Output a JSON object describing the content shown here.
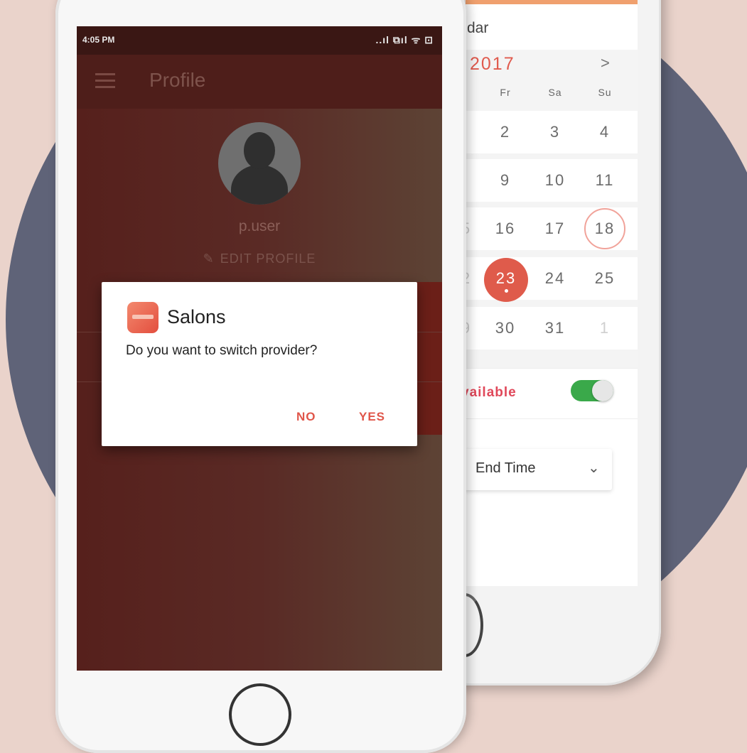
{
  "status_bar": {
    "time": "4:05 PM",
    "icons_text": "..ıl ⧉ıl ᯤ ⊡"
  },
  "profile": {
    "title": "Profile",
    "username": "p.user",
    "edit_label": "EDIT PROFILE"
  },
  "dialog": {
    "app_name": "Salons",
    "message": "Do you want to switch provider?",
    "no_label": "NO",
    "yes_label": "YES"
  },
  "calendar": {
    "header_fragment": "dar",
    "month_label": "2017",
    "next_glyph": ">",
    "weekdays": [
      "Fr",
      "Sa",
      "Su"
    ],
    "rows": [
      [
        "2",
        "3",
        "4"
      ],
      [
        "9",
        "10",
        "11"
      ],
      [
        "16",
        "17",
        "18"
      ],
      [
        "23",
        "24",
        "25"
      ],
      [
        "30",
        "31",
        "1"
      ]
    ],
    "partial_left": [
      "",
      "",
      "5",
      "2",
      "9"
    ],
    "today": "18",
    "selected": "23",
    "available_label": "vailable",
    "available_on": true,
    "end_time_label": "End Time"
  },
  "colors": {
    "accent": "#df5b4b",
    "toggle_on": "#3aa94a",
    "background": "#ead3cb",
    "circle": "#5f6378"
  }
}
